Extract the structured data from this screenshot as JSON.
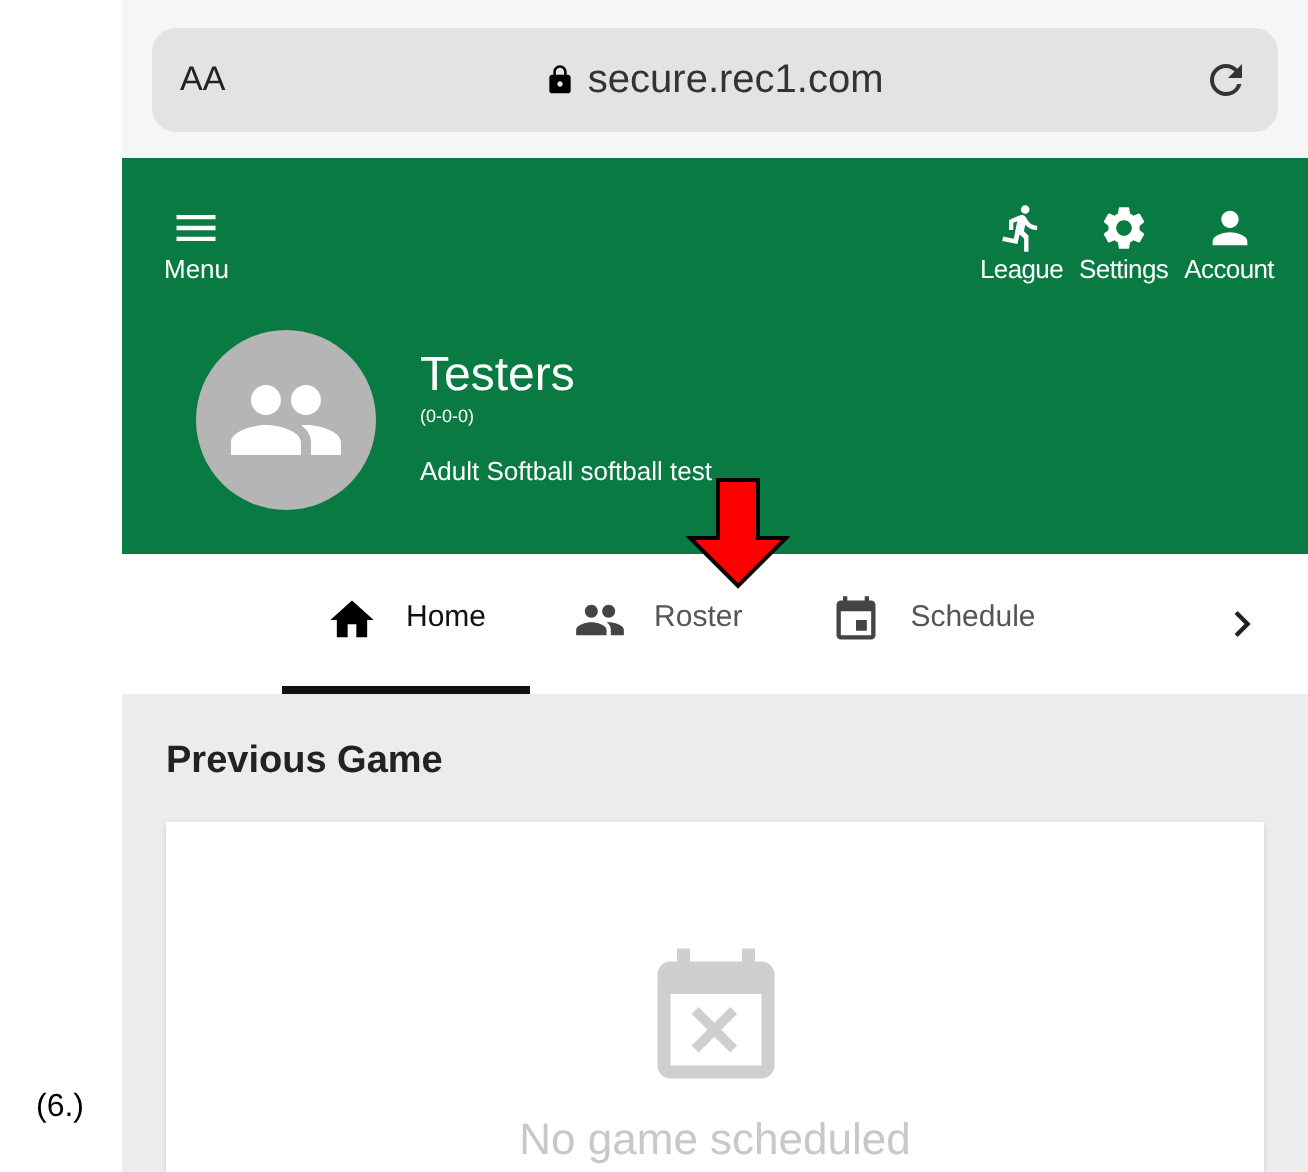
{
  "caption": "(6.)",
  "browser": {
    "text_size": "AA",
    "url": "secure.rec1.com"
  },
  "header": {
    "menu_label": "Menu",
    "actions": [
      {
        "label": "League"
      },
      {
        "label": "Settings"
      },
      {
        "label": "Account"
      }
    ]
  },
  "team": {
    "name": "Testers",
    "record": "(0-0-0)",
    "description": "Adult Softball softball test"
  },
  "tabs": [
    {
      "label": "Home",
      "selected": true
    },
    {
      "label": "Roster",
      "selected": false
    },
    {
      "label": "Schedule",
      "selected": false
    }
  ],
  "section": {
    "title": "Previous Game",
    "empty_message": "No game scheduled"
  }
}
